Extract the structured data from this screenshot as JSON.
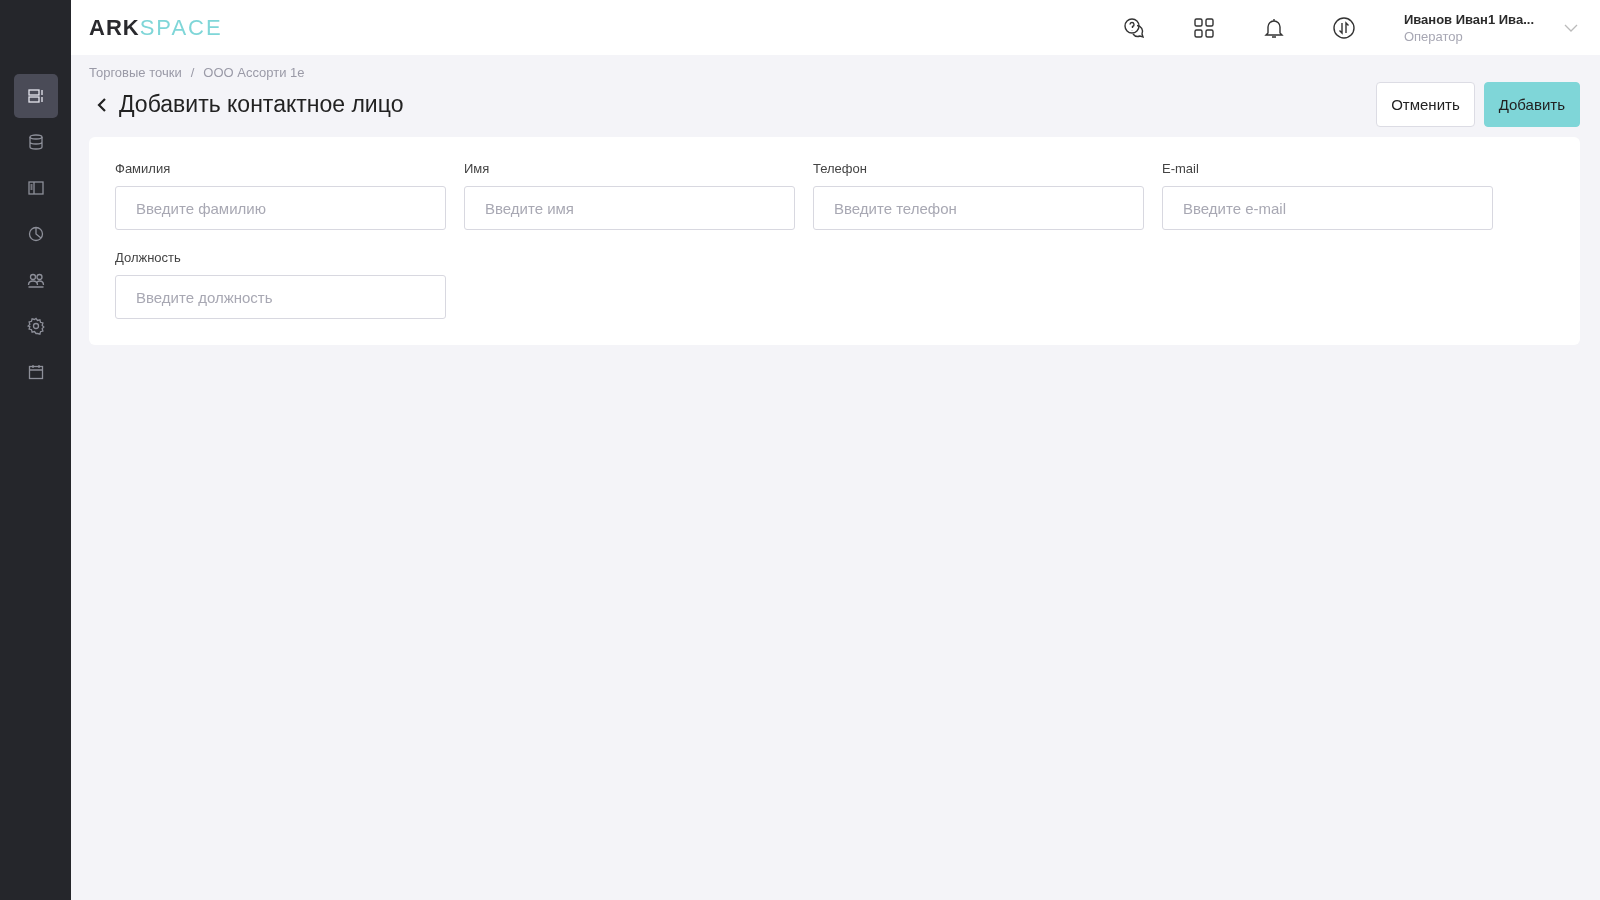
{
  "logo": {
    "part_1": "ARK",
    "part_2": "SPACE"
  },
  "sidebar": {
    "items": [
      {
        "kind": "list",
        "selected": true
      },
      {
        "kind": "database",
        "selected": false
      },
      {
        "kind": "panel",
        "selected": false
      },
      {
        "kind": "chart",
        "selected": false
      },
      {
        "kind": "users",
        "selected": false
      },
      {
        "kind": "settings",
        "selected": false
      },
      {
        "kind": "calendar",
        "selected": false
      }
    ]
  },
  "header": {
    "icons": [
      {
        "kind": "help"
      },
      {
        "kind": "apps"
      },
      {
        "kind": "bell"
      },
      {
        "kind": "sync"
      }
    ],
    "user": {
      "name": "Иванов Иван1 Ива...",
      "role": "Оператор"
    }
  },
  "breadcrumbs": [
    "Торговые точки",
    "ООО Ассорти 1е"
  ],
  "breadcrumb_separator": "/",
  "page_title": "Добавить контактное лицо",
  "buttons": [
    {
      "label": "Отменить",
      "kind": "secondary"
    },
    {
      "label": "Добавить",
      "kind": "primary"
    }
  ],
  "form": {
    "fields": [
      {
        "label": "Фамилия",
        "placeholder": "Введите фамилию"
      },
      {
        "label": "Имя",
        "placeholder": "Введите имя"
      },
      {
        "label": "Телефон",
        "placeholder": "Введите телефон"
      },
      {
        "label": "E-mail",
        "placeholder": "Введите e-mail"
      },
      {
        "label": "Должность",
        "placeholder": "Введите должность"
      }
    ]
  }
}
